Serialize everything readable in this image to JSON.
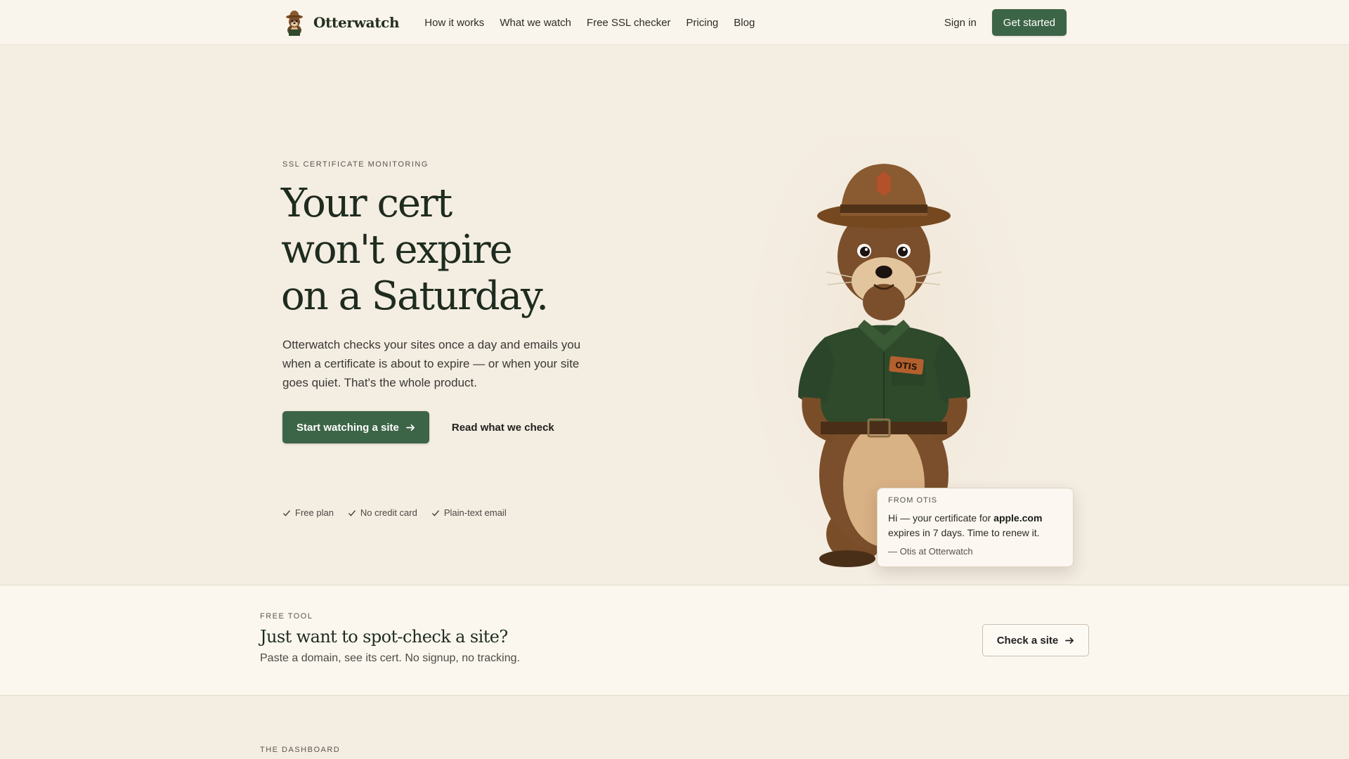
{
  "brand": {
    "name": "Otterwatch",
    "logo_icon": "otter-ranger-icon"
  },
  "nav": {
    "links": [
      "How it works",
      "What we watch",
      "Free SSL checker",
      "Pricing",
      "Blog"
    ],
    "signin": "Sign in",
    "cta": "Get started"
  },
  "hero": {
    "eyebrow": "SSL CERTIFICATE MONITORING",
    "title_lines": [
      "Your cert",
      "won't expire",
      "on a Saturday."
    ],
    "subtitle": "Otterwatch checks your sites once a day and emails you when a certificate is about to expire — or when your site goes quiet. That's the whole product.",
    "primary_cta": "Start watching a site",
    "secondary_cta": "Read what we check",
    "perks": [
      "Free plan",
      "No credit card",
      "Plain-text email"
    ]
  },
  "mascot": {
    "badge": "OTIS"
  },
  "note": {
    "eyebrow": "FROM OTIS",
    "msg_prefix": "Hi — your certificate for ",
    "domain": "apple.com",
    "msg_suffix": " expires in 7 days. Time to renew it.",
    "signature": "— Otis at Otterwatch"
  },
  "free_tool": {
    "eyebrow": "FREE TOOL",
    "title": "Just want to spot-check a site?",
    "subtitle": "Paste a domain, see its cert. No signup, no tracking.",
    "button": "Check a site"
  },
  "dashboard": {
    "eyebrow": "THE DASHBOARD"
  },
  "colors": {
    "accent": "#3c6446",
    "background": "#f4ede2",
    "nav_bg": "#faf5ec"
  }
}
